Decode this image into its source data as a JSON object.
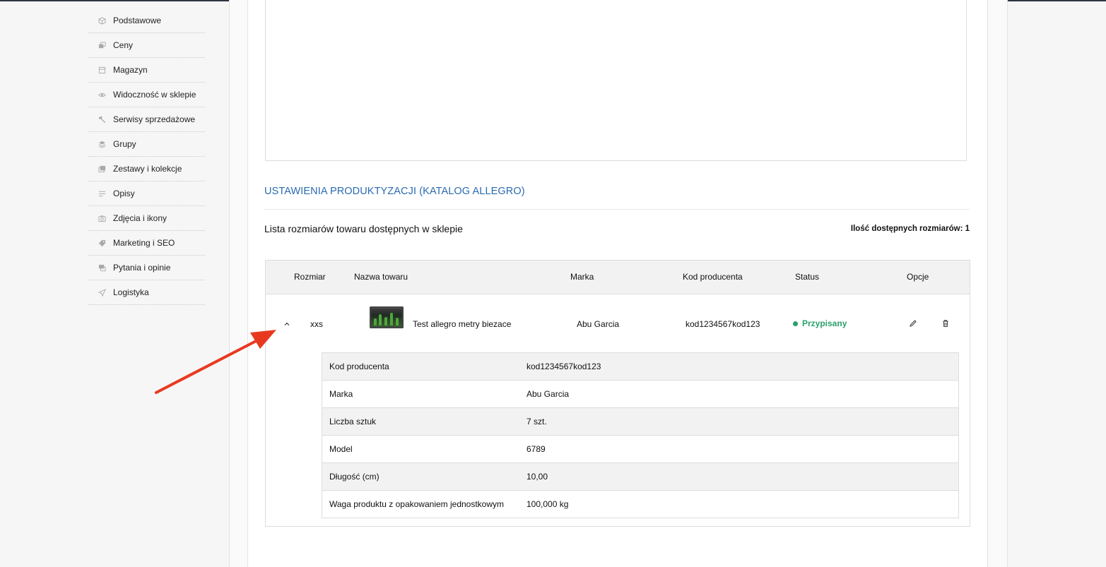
{
  "sidebar": {
    "items": [
      {
        "label": "Podstawowe",
        "icon": "box-icon"
      },
      {
        "label": "Ceny",
        "icon": "price-icon"
      },
      {
        "label": "Magazyn",
        "icon": "warehouse-icon"
      },
      {
        "label": "Widoczność w sklepie",
        "icon": "eye-icon"
      },
      {
        "label": "Serwisy sprzedażowe",
        "icon": "hammer-icon"
      },
      {
        "label": "Grupy",
        "icon": "layers-icon"
      },
      {
        "label": "Zestawy i kolekcje",
        "icon": "collection-icon"
      },
      {
        "label": "Opisy",
        "icon": "text-icon"
      },
      {
        "label": "Zdjęcia i ikony",
        "icon": "camera-icon"
      },
      {
        "label": "Marketing i SEO",
        "icon": "tag-icon"
      },
      {
        "label": "Pytania i opinie",
        "icon": "chat-icon"
      },
      {
        "label": "Logistyka",
        "icon": "send-icon"
      }
    ]
  },
  "section": {
    "title": "USTAWIENIA PRODUKTYZACJI (KATALOG ALLEGRO)",
    "list_title": "Lista rozmiarów towaru dostępnych w sklepie",
    "count_label": "Ilość dostępnych rozmiarów: 1"
  },
  "table": {
    "headers": {
      "size": "Rozmiar",
      "name": "Nazwa towaru",
      "brand": "Marka",
      "code": "Kod producenta",
      "status": "Status",
      "options": "Opcje"
    },
    "row": {
      "size": "xxs",
      "name": "Test allegro metry biezace",
      "brand": "Abu Garcia",
      "code": "kod1234567kod123",
      "status": "Przypisany",
      "status_color": "#29a06b"
    },
    "details": [
      {
        "key": "Kod producenta",
        "value": "kod1234567kod123"
      },
      {
        "key": "Marka",
        "value": "Abu Garcia"
      },
      {
        "key": "Liczba sztuk",
        "value": "7 szt."
      },
      {
        "key": "Model",
        "value": "6789"
      },
      {
        "key": "Długość (cm)",
        "value": "10,00"
      },
      {
        "key": "Waga produktu z opakowaniem jednostkowym",
        "value": "100,000 kg"
      }
    ]
  },
  "colors": {
    "accent": "#2a6bb0",
    "annotation_arrow": "#e8391f"
  }
}
